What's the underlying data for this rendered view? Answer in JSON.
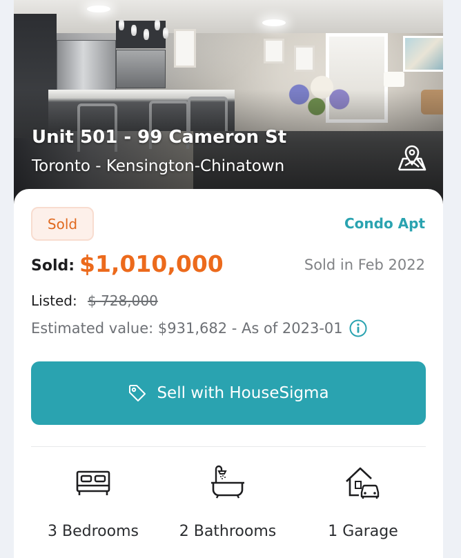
{
  "listing": {
    "address": "Unit 501 - 99 Cameron St",
    "location": "Toronto - Kensington-Chinatown",
    "status": "Sold",
    "property_type": "Condo Apt",
    "sold_label": "Sold:",
    "sold_price": "$1,010,000",
    "sold_date": "Sold in Feb 2022",
    "listed_label": "Listed:",
    "listed_price": "$ 728,000",
    "estimate_text": "Estimated value: $931,682 - As of 2023-01"
  },
  "actions": {
    "sell_label": "Sell with HouseSigma"
  },
  "features": [
    {
      "icon": "bed-icon",
      "label": "3 Bedrooms"
    },
    {
      "icon": "bathtub-icon",
      "label": "2 Bathrooms"
    },
    {
      "icon": "garage-icon",
      "label": "1 Garage"
    }
  ],
  "icons": {
    "map": "map-pin-icon",
    "info": "info-icon",
    "tag": "tag-icon"
  },
  "colors": {
    "accent": "#2aa3b0",
    "price": "#ec6a1c",
    "status_bg": "#fdf0ea",
    "status_text": "#e0691f"
  }
}
